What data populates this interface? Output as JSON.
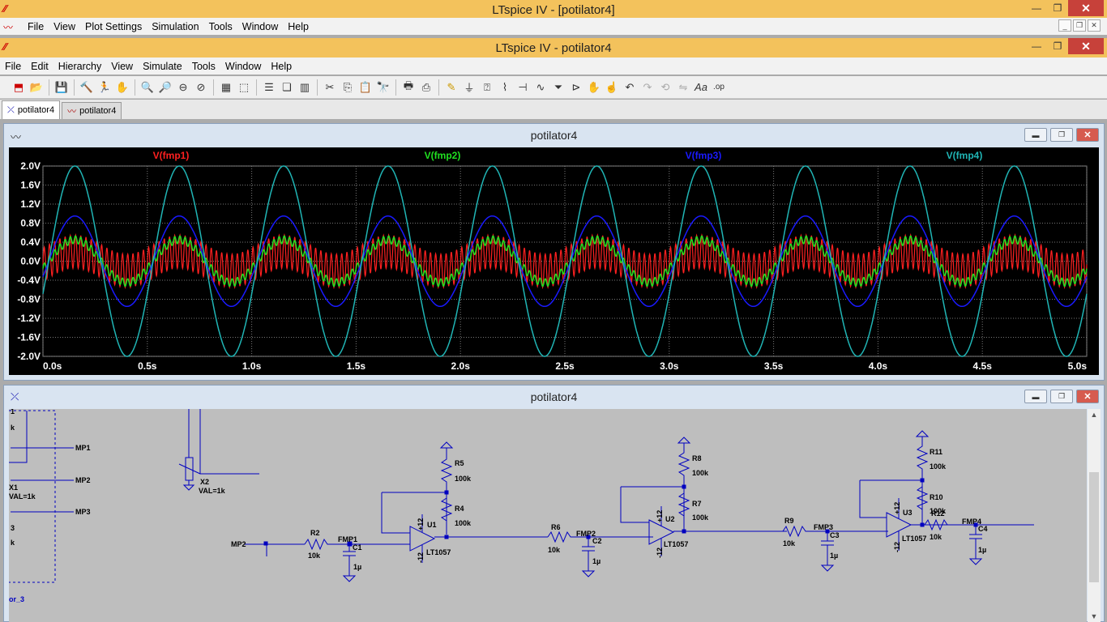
{
  "app": {
    "title": "LTspice IV - [potilator4]",
    "menus": [
      "File",
      "View",
      "Plot Settings",
      "Simulation",
      "Tools",
      "Window",
      "Help"
    ]
  },
  "child": {
    "title": "LTspice IV - potilator4",
    "menus": [
      "File",
      "Edit",
      "Hierarchy",
      "View",
      "Simulate",
      "Tools",
      "Window",
      "Help"
    ]
  },
  "tabs": [
    {
      "label": "potilator4",
      "icon": "schematic-icon"
    },
    {
      "label": "potilator4",
      "icon": "waveform-icon"
    }
  ],
  "waveform_window": {
    "title": "potilator4"
  },
  "schematic_window": {
    "title": "potilator4"
  },
  "chart_data": {
    "type": "line",
    "xlim": [
      0,
      5
    ],
    "ylim": [
      -2,
      2
    ],
    "xticks": [
      "0.0s",
      "0.5s",
      "1.0s",
      "1.5s",
      "2.0s",
      "2.5s",
      "3.0s",
      "3.5s",
      "4.0s",
      "4.5s",
      "5.0s"
    ],
    "yticks": [
      "2.0V",
      "1.6V",
      "1.2V",
      "0.8V",
      "0.4V",
      "0.0V",
      "-0.4V",
      "-0.8V",
      "-1.2V",
      "-1.6V",
      "-2.0V"
    ],
    "grid": true,
    "series": [
      {
        "name": "V(fmp1)",
        "color": "#ff2020",
        "base_amplitude": 0.2,
        "base_freq_hz": 2,
        "ripple_amplitude": 0.35,
        "ripple_freq_hz": 40
      },
      {
        "name": "V(fmp2)",
        "color": "#20e020",
        "base_amplitude": 0.45,
        "base_freq_hz": 2,
        "ripple_amplitude": 0.08,
        "ripple_freq_hz": 40
      },
      {
        "name": "V(fmp3)",
        "color": "#1a1aff",
        "base_amplitude": 0.95,
        "base_freq_hz": 2
      },
      {
        "name": "V(fmp4)",
        "color": "#20b5b5",
        "base_amplitude": 2.0,
        "base_freq_hz": 2
      }
    ]
  },
  "schematic": {
    "labels": {
      "mp1": "MP1",
      "mp2": "MP2",
      "mp3": "MP3",
      "mp2_in": "MP2",
      "x2": "X2",
      "x2val": "VAL=1k",
      "x1": "X1",
      "x1val": "VAL=1k",
      "x3": "3",
      "lbl_k1": "k",
      "lbl_k2": "k",
      "lbl_1": "1",
      "port": "or_3",
      "r2": "R2",
      "r2v": "10k",
      "fmp1": "FMP1",
      "c1": "C1",
      "c1v": "1µ",
      "r5": "R5",
      "r5v": "100k",
      "r4": "R4",
      "r4v": "100k",
      "u1": "U1",
      "u1p": "LT1057",
      "u1plus": "+12",
      "u1minus": "-12",
      "r6": "R6",
      "r6v": "10k",
      "fmp2": "FMP2",
      "c2": "C2",
      "c2v": "1µ",
      "r8": "R8",
      "r8v": "100k",
      "r7": "R7",
      "r7v": "100k",
      "u2": "U2",
      "u2p": "LT1057",
      "u2plus": "+12",
      "u2minus": "-12",
      "r9": "R9",
      "r9v": "10k",
      "fmp3": "FMP3",
      "c3": "C3",
      "c3v": "1µ",
      "r11": "R11",
      "r11v": "100k",
      "r10": "R10",
      "r10v": "100k",
      "u3": "U3",
      "u3p": "LT1057",
      "u3plus": "+12",
      "u3minus": "-12",
      "r12": "R12",
      "r12v": "10k",
      "fmp4": "FMP4",
      "c4": "C4",
      "c4v": "1µ"
    }
  }
}
